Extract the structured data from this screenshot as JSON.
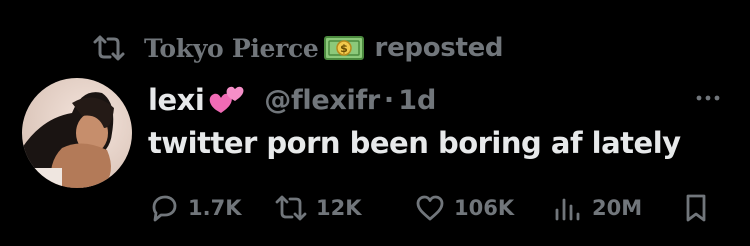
{
  "repost_banner": {
    "reposter_name": "Tokyo Pierce",
    "reposter_emoji": "money-with-dollar-bill-emoji",
    "label": "reposted",
    "icon": "repost-icon"
  },
  "tweet": {
    "display_name": "lexi",
    "name_emoji": "two-hearts-emoji",
    "handle": "@flexifr",
    "separator": "·",
    "time": "1d",
    "text": "twitter porn been boring af lately",
    "more_icon": "more-horizontal-icon"
  },
  "actions": {
    "replies": {
      "icon": "reply-icon",
      "count": "1.7K"
    },
    "reposts": {
      "icon": "repost-icon",
      "count": "12K"
    },
    "likes": {
      "icon": "heart-icon",
      "count": "106K"
    },
    "views": {
      "icon": "views-icon",
      "count": "20M"
    },
    "bookmark": {
      "icon": "bookmark-icon"
    }
  },
  "colors": {
    "background": "#000000",
    "primary_text": "#e7e9ea",
    "secondary_text": "#71767b"
  }
}
